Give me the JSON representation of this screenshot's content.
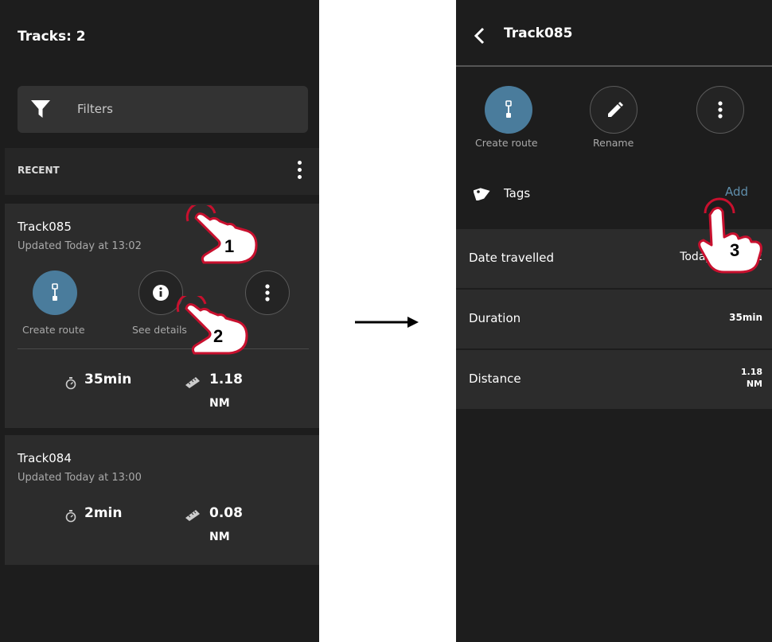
{
  "left": {
    "title": "Tracks: 2",
    "filter_label": "Filters",
    "recent_label": "RECENT",
    "tracks": [
      {
        "name": "Track085",
        "updated": "Updated Today at 13:02",
        "actions": [
          "Create route",
          "See details"
        ],
        "duration": "35min",
        "distance_value": "1.18",
        "distance_unit": "NM"
      },
      {
        "name": "Track084",
        "updated": "Updated Today at 13:00",
        "duration": "2min",
        "distance_value": "0.08",
        "distance_unit": "NM"
      }
    ]
  },
  "right": {
    "title": "Track085",
    "actions": [
      "Create route",
      "Rename"
    ],
    "tags_label": "Tags",
    "tags_add": "Add",
    "details": [
      {
        "key": "Date travelled",
        "value": "Today at 13:02"
      },
      {
        "key": "Duration",
        "value": "35min"
      },
      {
        "key": "Distance",
        "value_line1": "1.18",
        "value_line2": "NM"
      }
    ]
  },
  "steps": [
    "1",
    "2",
    "3"
  ],
  "colors": {
    "accent": "#4a7c9c",
    "link": "#5f8eab",
    "hand_outline": "#c8102e",
    "panel_bg": "#1d1d1d",
    "card_bg": "#2c2c2c"
  },
  "icons": [
    "filter-icon",
    "kebab-menu-icon",
    "route-icon",
    "info-icon",
    "pencil-icon",
    "tag-icon",
    "stopwatch-icon",
    "ruler-icon",
    "back-chevron-icon",
    "arrow-right-icon",
    "tap-hand-icon"
  ]
}
